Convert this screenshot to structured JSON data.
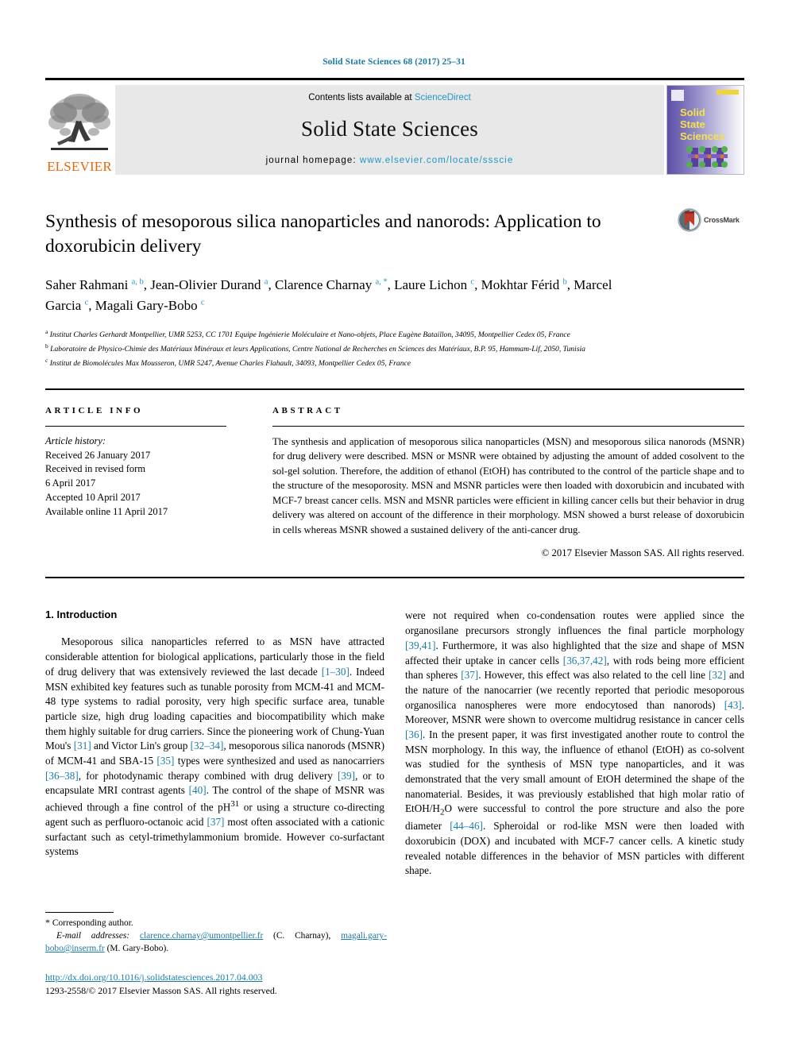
{
  "running_head": "Solid State Sciences 68 (2017) 25–31",
  "masthead": {
    "publisher_name": "ELSEVIER",
    "contents_prefix": "Contents lists available at ",
    "contents_link": "ScienceDirect",
    "journal_name": "Solid State Sciences",
    "homepage_prefix": "journal homepage: ",
    "homepage_url": "www.elsevier.com/locate/ssscie",
    "cover_title_lines": [
      "Solid",
      "State",
      "Sciences"
    ],
    "link_color": "#2196c4",
    "brand_color": "#eb6608"
  },
  "article": {
    "title": "Synthesis of mesoporous silica nanoparticles and nanorods: Application to doxorubicin delivery",
    "crossmark_label": "CrossMark",
    "authors_html": "Saher Rahmani <sup>a, b</sup>, Jean-Olivier Durand <sup>a</sup>, Clarence Charnay <sup>a, *</sup>, Laure Lichon <sup>c</sup>, Mokhtar Férid <sup>b</sup>, Marcel Garcia <sup>c</sup>, Magali Gary-Bobo <sup>c</sup>",
    "affiliations": [
      {
        "marker": "a",
        "text": "Institut Charles Gerhardt Montpellier, UMR 5253, CC 1701 Equipe Ingénierie Moléculaire et Nano-objets, Place Eugène Bataillon, 34095, Montpellier Cedex 05, France"
      },
      {
        "marker": "b",
        "text": "Laboratoire de Physico-Chimie des Matériaux Minéraux et leurs Applications, Centre National de Recherches en Sciences des Matériaux, B.P. 95, Hammam-Lif, 2050, Tunisia"
      },
      {
        "marker": "c",
        "text": "Institut de Biomolécules Max Mousseron, UMR 5247, Avenue Charles Flahault, 34093, Montpellier Cedex 05, France"
      }
    ]
  },
  "article_info": {
    "heading": "ARTICLE INFO",
    "history_label": "Article history:",
    "history": [
      "Received 26 January 2017",
      "Received in revised form",
      "6 April 2017",
      "Accepted 10 April 2017",
      "Available online 11 April 2017"
    ]
  },
  "abstract": {
    "heading": "ABSTRACT",
    "text": "The synthesis and application of mesoporous silica nanoparticles (MSN) and mesoporous silica nanorods (MSNR) for drug delivery were described. MSN or MSNR were obtained by adjusting the amount of added cosolvent to the sol-gel solution. Therefore, the addition of ethanol (EtOH) has contributed to the control of the particle shape and to the structure of the mesoporosity. MSN and MSNR particles were then loaded with doxorubicin and incubated with MCF-7 breast cancer cells. MSN and MSNR particles were efficient in killing cancer cells but their behavior in drug delivery was altered on account of the difference in their morphology. MSN showed a burst release of doxorubicin in cells whereas MSNR showed a sustained delivery of the anti-cancer drug.",
    "copyright": "© 2017 Elsevier Masson SAS. All rights reserved."
  },
  "body": {
    "section_number_title": "1. Introduction",
    "left_paragraph_html": "Mesoporous silica nanoparticles referred to as MSN have attracted considerable attention for biological applications, particularly those in the field of drug delivery that was extensively reviewed the last decade <span class=\"ref\">[1–30]</span>. Indeed MSN exhibited key features such as tunable porosity from MCM-41 and MCM-48 type systems to radial porosity, very high specific surface area, tunable particle size, high drug loading capacities and biocompatibility which make them highly suitable for drug carriers. Since the pioneering work of Chung-Yuan Mou's <span class=\"ref\">[31]</span> and Victor Lin's group <span class=\"ref\">[32–34]</span>, mesoporous silica nanorods (MSNR) of MCM-41 and SBA-15 <span class=\"ref\">[35]</span> types were synthesized and used as nanocarriers <span class=\"ref\">[36–38]</span>, for photodynamic therapy combined with drug delivery <span class=\"ref\">[39]</span>, or to encapsulate MRI contrast agents <span class=\"ref\">[40]</span>. The control of the shape of MSNR was achieved through a fine control of the pH<sup>31</sup> or using a structure co-directing agent such as perfluoro-octanoic acid <span class=\"ref\">[37]</span> most often associated with a cationic surfactant such as cetyl-trimethylammonium bromide. However co-surfactant systems",
    "right_paragraph_html": "were not required when co-condensation routes were applied since the organosilane precursors strongly influences the final particle morphology <span class=\"ref\">[39,41]</span>. Furthermore, it was also highlighted that the size and shape of MSN affected their uptake in cancer cells <span class=\"ref\">[36,37,42]</span>, with rods being more efficient than spheres <span class=\"ref\">[37]</span>. However, this effect was also related to the cell line <span class=\"ref\">[32]</span> and the nature of the nanocarrier (we recently reported that periodic mesoporous organosilica nanospheres were more endocytosed than nanorods) <span class=\"ref\">[43]</span>. Moreover, MSNR were shown to overcome multidrug resistance in cancer cells <span class=\"ref\">[36]</span>. In the present paper, it was first investigated another route to control the MSN morphology. In this way, the influence of ethanol (EtOH) as co-solvent was studied for the synthesis of MSN type nanoparticles, and it was demonstrated that the very small amount of EtOH determined the shape of the nanomaterial. Besides, it was previously established that high molar ratio of EtOH/H<sub>2</sub>O were successful to control the pore structure and also the pore diameter <span class=\"ref\">[44–46]</span>. Spheroidal or rod-like MSN were then loaded with doxorubicin (DOX) and incubated with MCF-7 cancer cells. A kinetic study revealed notable differences in the behavior of MSN particles with different shape."
  },
  "footer": {
    "corresponding_marker": "*",
    "corresponding_label": "Corresponding author.",
    "email_label": "E-mail addresses:",
    "email_1": "clarence.charnay@umontpellier.fr",
    "email_1_owner": "(C. Charnay)",
    "email_2": "magali.gary-bobo@inserm.fr",
    "email_2_owner": "(M. Gary-Bobo).",
    "doi_url": "http://dx.doi.org/10.1016/j.solidstatesciences.2017.04.003",
    "issn_line": "1293-2558/© 2017 Elsevier Masson SAS. All rights reserved."
  }
}
